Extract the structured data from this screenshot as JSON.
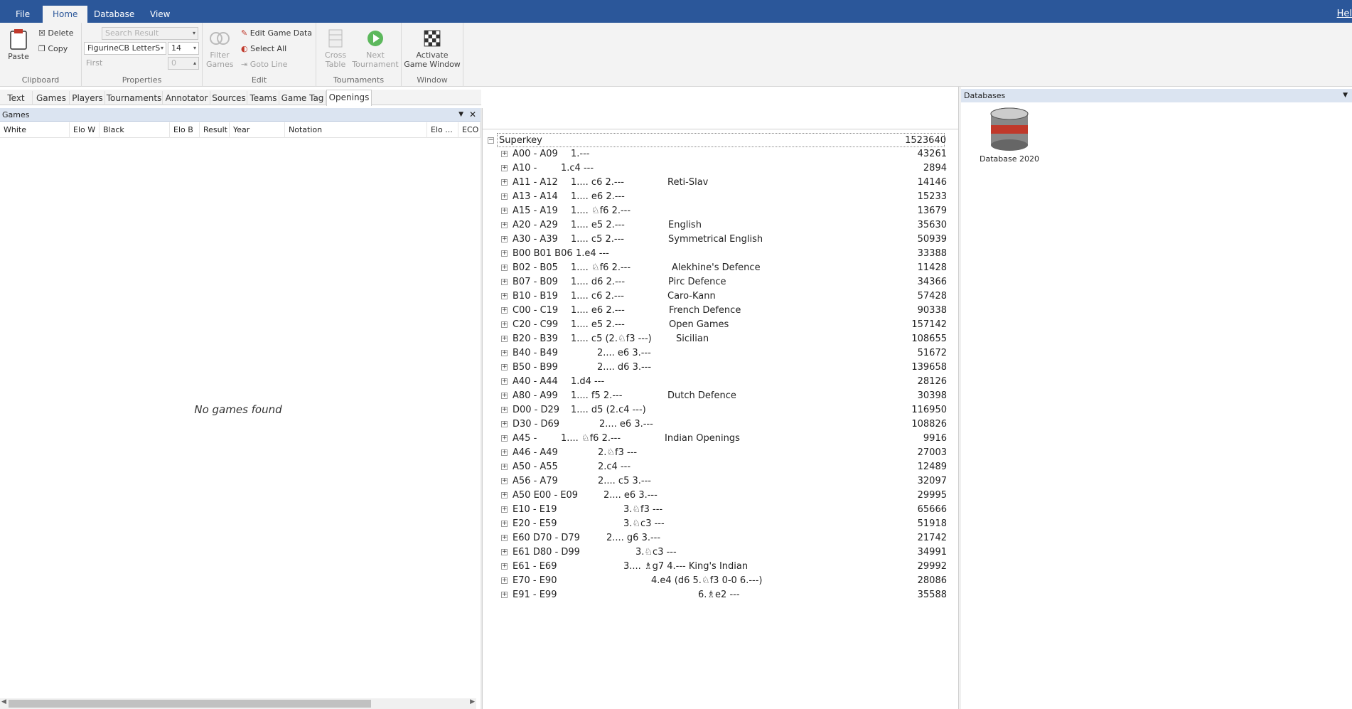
{
  "menu": {
    "file": "File",
    "home": "Home",
    "database": "Database",
    "view": "View",
    "help": "Hel"
  },
  "ribbon": {
    "clipboard": {
      "paste": "Paste",
      "delete": "Delete",
      "copy": "Copy",
      "label": "Clipboard"
    },
    "properties": {
      "search": "Search Result",
      "font": "FigurineCB LetterS",
      "size": "14",
      "first": "First",
      "first_val": "0",
      "label": "Properties"
    },
    "edit": {
      "filter": "Filter Games",
      "edit_game_data": "Edit Game Data",
      "select_all": "Select All",
      "goto_line": "Goto Line",
      "label": "Edit"
    },
    "tournaments": {
      "cross": "Cross Table",
      "next": "Next Tournament",
      "label": "Tournaments"
    },
    "window": {
      "activate": "Activate Game Window",
      "label": "Window"
    }
  },
  "tabs": [
    "Text",
    "Games",
    "Players",
    "Tournaments",
    "Annotator",
    "Sources",
    "Teams",
    "Game Tag",
    "Openings"
  ],
  "games": {
    "title": "Games",
    "columns": [
      "White",
      "Elo W",
      "Black",
      "Elo B",
      "Result",
      "Year",
      "Notation",
      "Elo ...",
      "ECO"
    ],
    "empty": "No games found"
  },
  "openings": {
    "root": {
      "key": "Superkey",
      "count": "1523640"
    },
    "rows": [
      {
        "key": "A00 - A09",
        "mv": "1.---",
        "mx": 124,
        "name": "",
        "count": "43261"
      },
      {
        "key": "A10 -",
        "mv": "1.c4  ---",
        "mx": 110,
        "name": "",
        "count": "2894"
      },
      {
        "key": "A11 - A12",
        "mv": "1.... c6  2.---",
        "mx": 124,
        "name": "Reti-Slav",
        "nx": 260,
        "count": "14146"
      },
      {
        "key": "A13 - A14",
        "mv": "1.... e6  2.---",
        "mx": 124,
        "name": "",
        "count": "15233"
      },
      {
        "key": "A15 - A19",
        "mv": "1.... ♘f6 2.---",
        "mx": 124,
        "name": "",
        "count": "13679"
      },
      {
        "key": "A20 - A29",
        "mv": "1.... e5  2.---",
        "mx": 124,
        "name": "English",
        "nx": 261,
        "count": "35630"
      },
      {
        "key": "A30 - A39",
        "mv": "1.... c5  2.---",
        "mx": 124,
        "name": "Symmetrical English",
        "nx": 261,
        "count": "50939"
      },
      {
        "key": "B00 B01 B06",
        "mv": "1.e4  ---",
        "mx": 131,
        "name": "",
        "count": "33388"
      },
      {
        "key": "B02 - B05",
        "mv": "1.... ♘f6 2.---",
        "mx": 124,
        "name": "Alekhine's Defence",
        "nx": 266,
        "count": "11428"
      },
      {
        "key": "B07 - B09",
        "mv": "1.... d6  2.---",
        "mx": 124,
        "name": "Pirc Defence",
        "nx": 261,
        "count": "34366"
      },
      {
        "key": "B10 - B19",
        "mv": "1.... c6  2.---",
        "mx": 124,
        "name": "Caro-Kann",
        "nx": 260,
        "count": "57428"
      },
      {
        "key": "C00 - C19",
        "mv": "1.... e6  2.---",
        "mx": 124,
        "name": "French Defence",
        "nx": 262,
        "count": "90338"
      },
      {
        "key": "C20 - C99",
        "mv": "1.... e5  2.---",
        "mx": 124,
        "name": "Open Games",
        "nx": 262,
        "count": "157142"
      },
      {
        "key": "B20 - B39",
        "mv": "1.... c5 (2.♘f3 ---)",
        "mx": 124,
        "name": "Sicilian",
        "nx": 272,
        "count": "108655"
      },
      {
        "key": "B40 - B49",
        "mv": "2.... e6  3.---",
        "mx": 161,
        "name": "",
        "count": "51672"
      },
      {
        "key": "B50 - B99",
        "mv": "2.... d6  3.---",
        "mx": 161,
        "name": "",
        "count": "139658"
      },
      {
        "key": "A40 - A44",
        "mv": "1.d4  ---",
        "mx": 124,
        "name": "",
        "count": "28126"
      },
      {
        "key": "A80 - A99",
        "mv": "1.... f5  2.---",
        "mx": 124,
        "name": "Dutch Defence",
        "nx": 260,
        "count": "30398"
      },
      {
        "key": "D00 - D29",
        "mv": "1.... d5 (2.c4  ---)",
        "mx": 124,
        "name": "",
        "count": "116950"
      },
      {
        "key": "D30 - D69",
        "mv": "2.... e6  3.---",
        "mx": 164,
        "name": "",
        "count": "108826"
      },
      {
        "key": "A45 -",
        "mv": "1.... ♘f6 2.---",
        "mx": 110,
        "name": "Indian Openings",
        "nx": 256,
        "count": "9916"
      },
      {
        "key": "A46 - A49",
        "mv": "2.♘f3 ---",
        "mx": 162,
        "name": "",
        "count": "27003"
      },
      {
        "key": "A50 - A55",
        "mv": "2.c4  ---",
        "mx": 162,
        "name": "",
        "count": "12489"
      },
      {
        "key": "A56 - A79",
        "mv": "2.... c5  3.---",
        "mx": 162,
        "name": "",
        "count": "32097"
      },
      {
        "key": "A50 E00 - E09",
        "mv": "2.... e6  3.---",
        "mx": 170,
        "name": "",
        "count": "29995"
      },
      {
        "key": "E10 - E19",
        "mv": "3.♘f3 ---",
        "mx": 198,
        "name": "",
        "count": "65666"
      },
      {
        "key": "E20 - E59",
        "mv": "3.♘c3 ---",
        "mx": 198,
        "name": "",
        "count": "51918"
      },
      {
        "key": "E60 D70 - D79",
        "mv": "2.... g6  3.---",
        "mx": 174,
        "name": "",
        "count": "21742"
      },
      {
        "key": "E61 D80 - D99",
        "mv": "3.♘c3 ---",
        "mx": 215,
        "name": "",
        "count": "34991"
      },
      {
        "key": "E61 - E69",
        "mv": "3.... ♗g7 4.--- King's Indian",
        "mx": 198,
        "name": "",
        "count": "29992"
      },
      {
        "key": "E70 - E90",
        "mv": "4.e4 (d6 5.♘f3 0-0 6.---)",
        "mx": 237,
        "name": "",
        "count": "28086"
      },
      {
        "key": "E91 - E99",
        "mv": "6.♗e2 ---",
        "mx": 303,
        "name": "",
        "count": "35588"
      }
    ]
  },
  "databases": {
    "title": "Databases",
    "item": "Database 2020"
  }
}
